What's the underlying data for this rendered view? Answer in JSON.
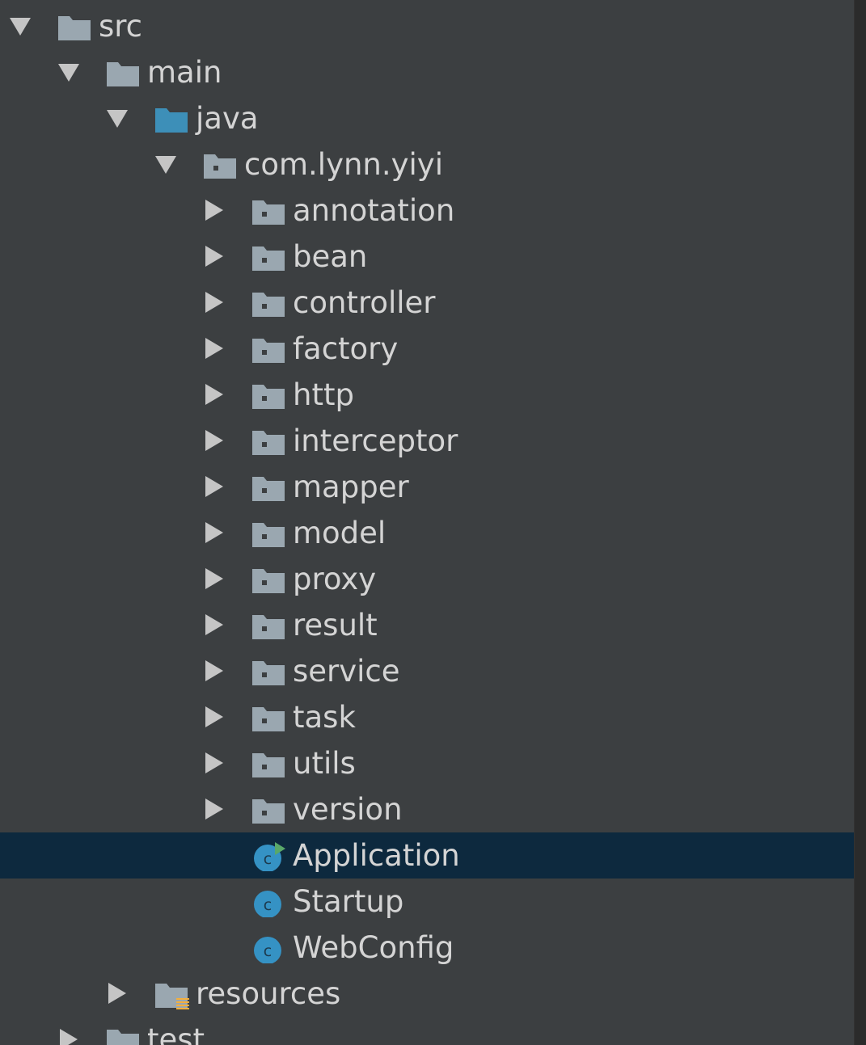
{
  "project_tree": {
    "rows": [
      {
        "label": "src",
        "depth": 0,
        "arrow": "down",
        "icon": "folder-icon"
      },
      {
        "label": "main",
        "depth": 1,
        "arrow": "down",
        "icon": "folder-icon"
      },
      {
        "label": "java",
        "depth": 2,
        "arrow": "down",
        "icon": "source-folder-icon"
      },
      {
        "label": "com.lynn.yiyi",
        "depth": 3,
        "arrow": "down",
        "icon": "package-icon"
      },
      {
        "label": "annotation",
        "depth": 4,
        "arrow": "right",
        "icon": "package-icon"
      },
      {
        "label": "bean",
        "depth": 4,
        "arrow": "right",
        "icon": "package-icon"
      },
      {
        "label": "controller",
        "depth": 4,
        "arrow": "right",
        "icon": "package-icon"
      },
      {
        "label": "factory",
        "depth": 4,
        "arrow": "right",
        "icon": "package-icon"
      },
      {
        "label": "http",
        "depth": 4,
        "arrow": "right",
        "icon": "package-icon"
      },
      {
        "label": "interceptor",
        "depth": 4,
        "arrow": "right",
        "icon": "package-icon"
      },
      {
        "label": "mapper",
        "depth": 4,
        "arrow": "right",
        "icon": "package-icon"
      },
      {
        "label": "model",
        "depth": 4,
        "arrow": "right",
        "icon": "package-icon"
      },
      {
        "label": "proxy",
        "depth": 4,
        "arrow": "right",
        "icon": "package-icon"
      },
      {
        "label": "result",
        "depth": 4,
        "arrow": "right",
        "icon": "package-icon"
      },
      {
        "label": "service",
        "depth": 4,
        "arrow": "right",
        "icon": "package-icon"
      },
      {
        "label": "task",
        "depth": 4,
        "arrow": "right",
        "icon": "package-icon"
      },
      {
        "label": "utils",
        "depth": 4,
        "arrow": "right",
        "icon": "package-icon"
      },
      {
        "label": "version",
        "depth": 4,
        "arrow": "right",
        "icon": "package-icon"
      },
      {
        "label": "Application",
        "depth": 4,
        "arrow": "none",
        "icon": "runnable-class-icon",
        "selected": true
      },
      {
        "label": "Startup",
        "depth": 4,
        "arrow": "none",
        "icon": "class-icon"
      },
      {
        "label": "WebConfig",
        "depth": 4,
        "arrow": "none",
        "icon": "class-icon"
      },
      {
        "label": "resources",
        "depth": 2,
        "arrow": "right",
        "icon": "resources-folder-icon"
      },
      {
        "label": "test",
        "depth": 1,
        "arrow": "right",
        "icon": "folder-icon"
      }
    ]
  },
  "colors": {
    "background": "#3c3f41",
    "selection": "#0d293e",
    "text": "#d4d4d4",
    "folder": "#9aa7b0",
    "source_folder": "#3d8fb8",
    "class_icon": "#3592c4",
    "run_marker": "#59a869",
    "resources_marker": "#f4af3d"
  }
}
